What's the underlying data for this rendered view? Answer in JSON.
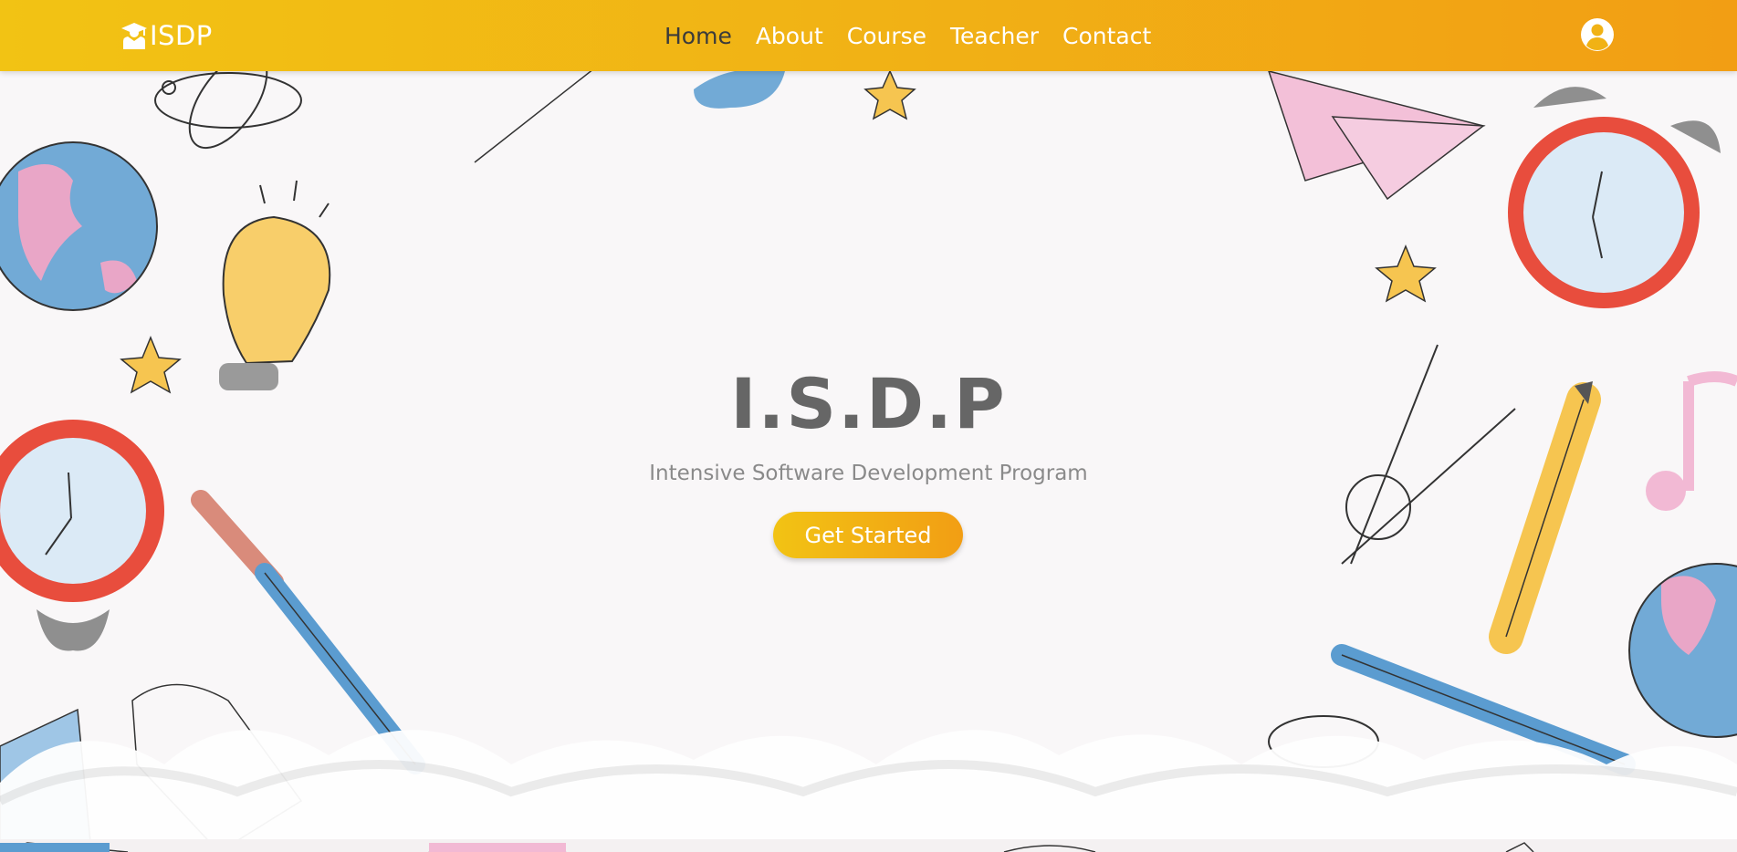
{
  "brand": {
    "name": "ISDP",
    "icon": "graduate-icon"
  },
  "nav": {
    "items": [
      {
        "label": "Home",
        "active": true
      },
      {
        "label": "About",
        "active": false
      },
      {
        "label": "Course",
        "active": false
      },
      {
        "label": "Teacher",
        "active": false
      },
      {
        "label": "Contact",
        "active": false
      }
    ],
    "account_icon": "user-circle-icon"
  },
  "hero": {
    "title": "I.S.D.P",
    "subtitle": "Intensive Software Development Program",
    "cta_label": "Get Started"
  },
  "colors": {
    "brand_start": "#f2c314",
    "brand_end": "#f29e14",
    "active_nav": "#3b3b3b",
    "title": "#666666",
    "subtitle": "#8a8a8a"
  }
}
